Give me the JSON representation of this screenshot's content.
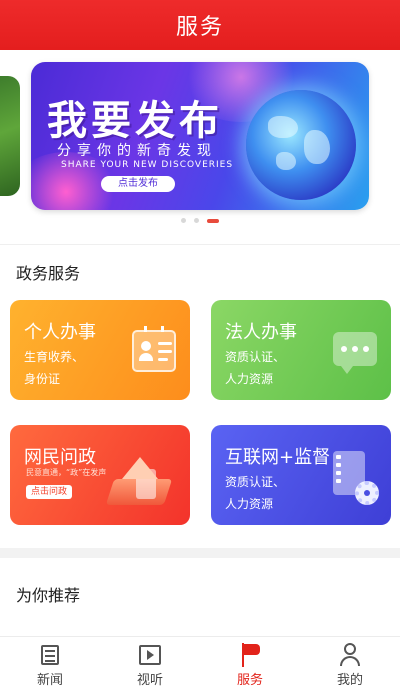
{
  "header": {
    "title": "服务"
  },
  "banner": {
    "title": "我要发布",
    "subtitle": "分享你的新奇发现",
    "subtitle_en": "SHARE YOUR NEW DISCOVERIES",
    "button_label": "点击发布",
    "active_slide_index": 2,
    "slide_count": 3
  },
  "gov_services": {
    "title": "政务服务",
    "cards": [
      {
        "title": "个人办事",
        "line1": "生育收养、",
        "line2": "身份证",
        "icon": "id-card-icon"
      },
      {
        "title": "法人办事",
        "line1": "资质认证、",
        "line2": "人力资源",
        "icon": "chat-bubble-icon"
      },
      {
        "title": "网民问政",
        "subtitle": "民意直通，“政”在发声",
        "button": "点击问政",
        "icon": "house-phone-illustration"
      },
      {
        "title": "互联网+监督",
        "line1": "资质认证、",
        "line2": "人力资源",
        "icon": "document-gear-icon"
      }
    ]
  },
  "recommend": {
    "title": "为你推荐"
  },
  "tabbar": {
    "items": [
      {
        "label": "新闻",
        "icon": "news-icon"
      },
      {
        "label": "视听",
        "icon": "video-icon"
      },
      {
        "label": "服务",
        "icon": "flag-icon",
        "active": true
      },
      {
        "label": "我的",
        "icon": "user-icon"
      }
    ]
  },
  "colors": {
    "accent": "#e2231a",
    "header": "#e82626"
  }
}
